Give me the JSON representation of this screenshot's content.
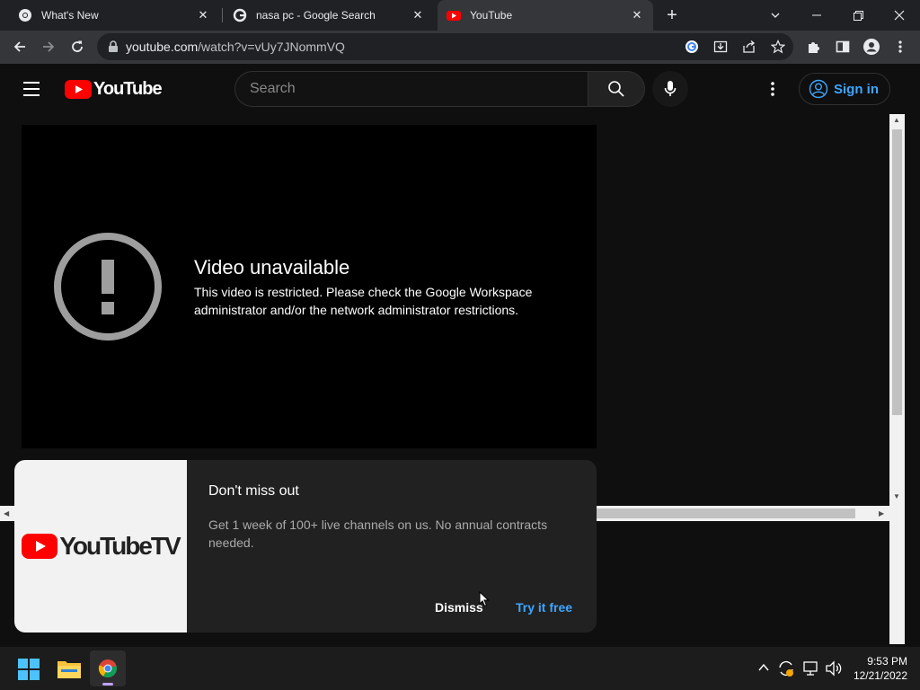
{
  "browser": {
    "tabs": [
      {
        "title": "What's New",
        "icon": "chrome-icon",
        "active": false
      },
      {
        "title": "nasa pc - Google Search",
        "icon": "google-icon",
        "active": false
      },
      {
        "title": "YouTube",
        "icon": "youtube-icon",
        "active": true
      }
    ],
    "url_host": "youtube.com",
    "url_path": "/watch?v=vUy7JNommVQ"
  },
  "youtube": {
    "logo_text": "YouTube",
    "search_placeholder": "Search",
    "signin_label": "Sign in",
    "error_title": "Video unavailable",
    "error_message": "This video is restricted. Please check the Google Workspace administrator and/or the network administrator restrictions.",
    "promo": {
      "brand": "YouTubeTV",
      "title": "Don't miss out",
      "body": "Get 1 week of 100+ live channels on us. No annual contracts needed.",
      "dismiss_label": "Dismiss",
      "try_label": "Try it free"
    }
  },
  "taskbar": {
    "time": "9:53 PM",
    "date": "12/21/2022"
  },
  "colors": {
    "yt_red": "#ff0000",
    "link_blue": "#3ea6ff"
  }
}
